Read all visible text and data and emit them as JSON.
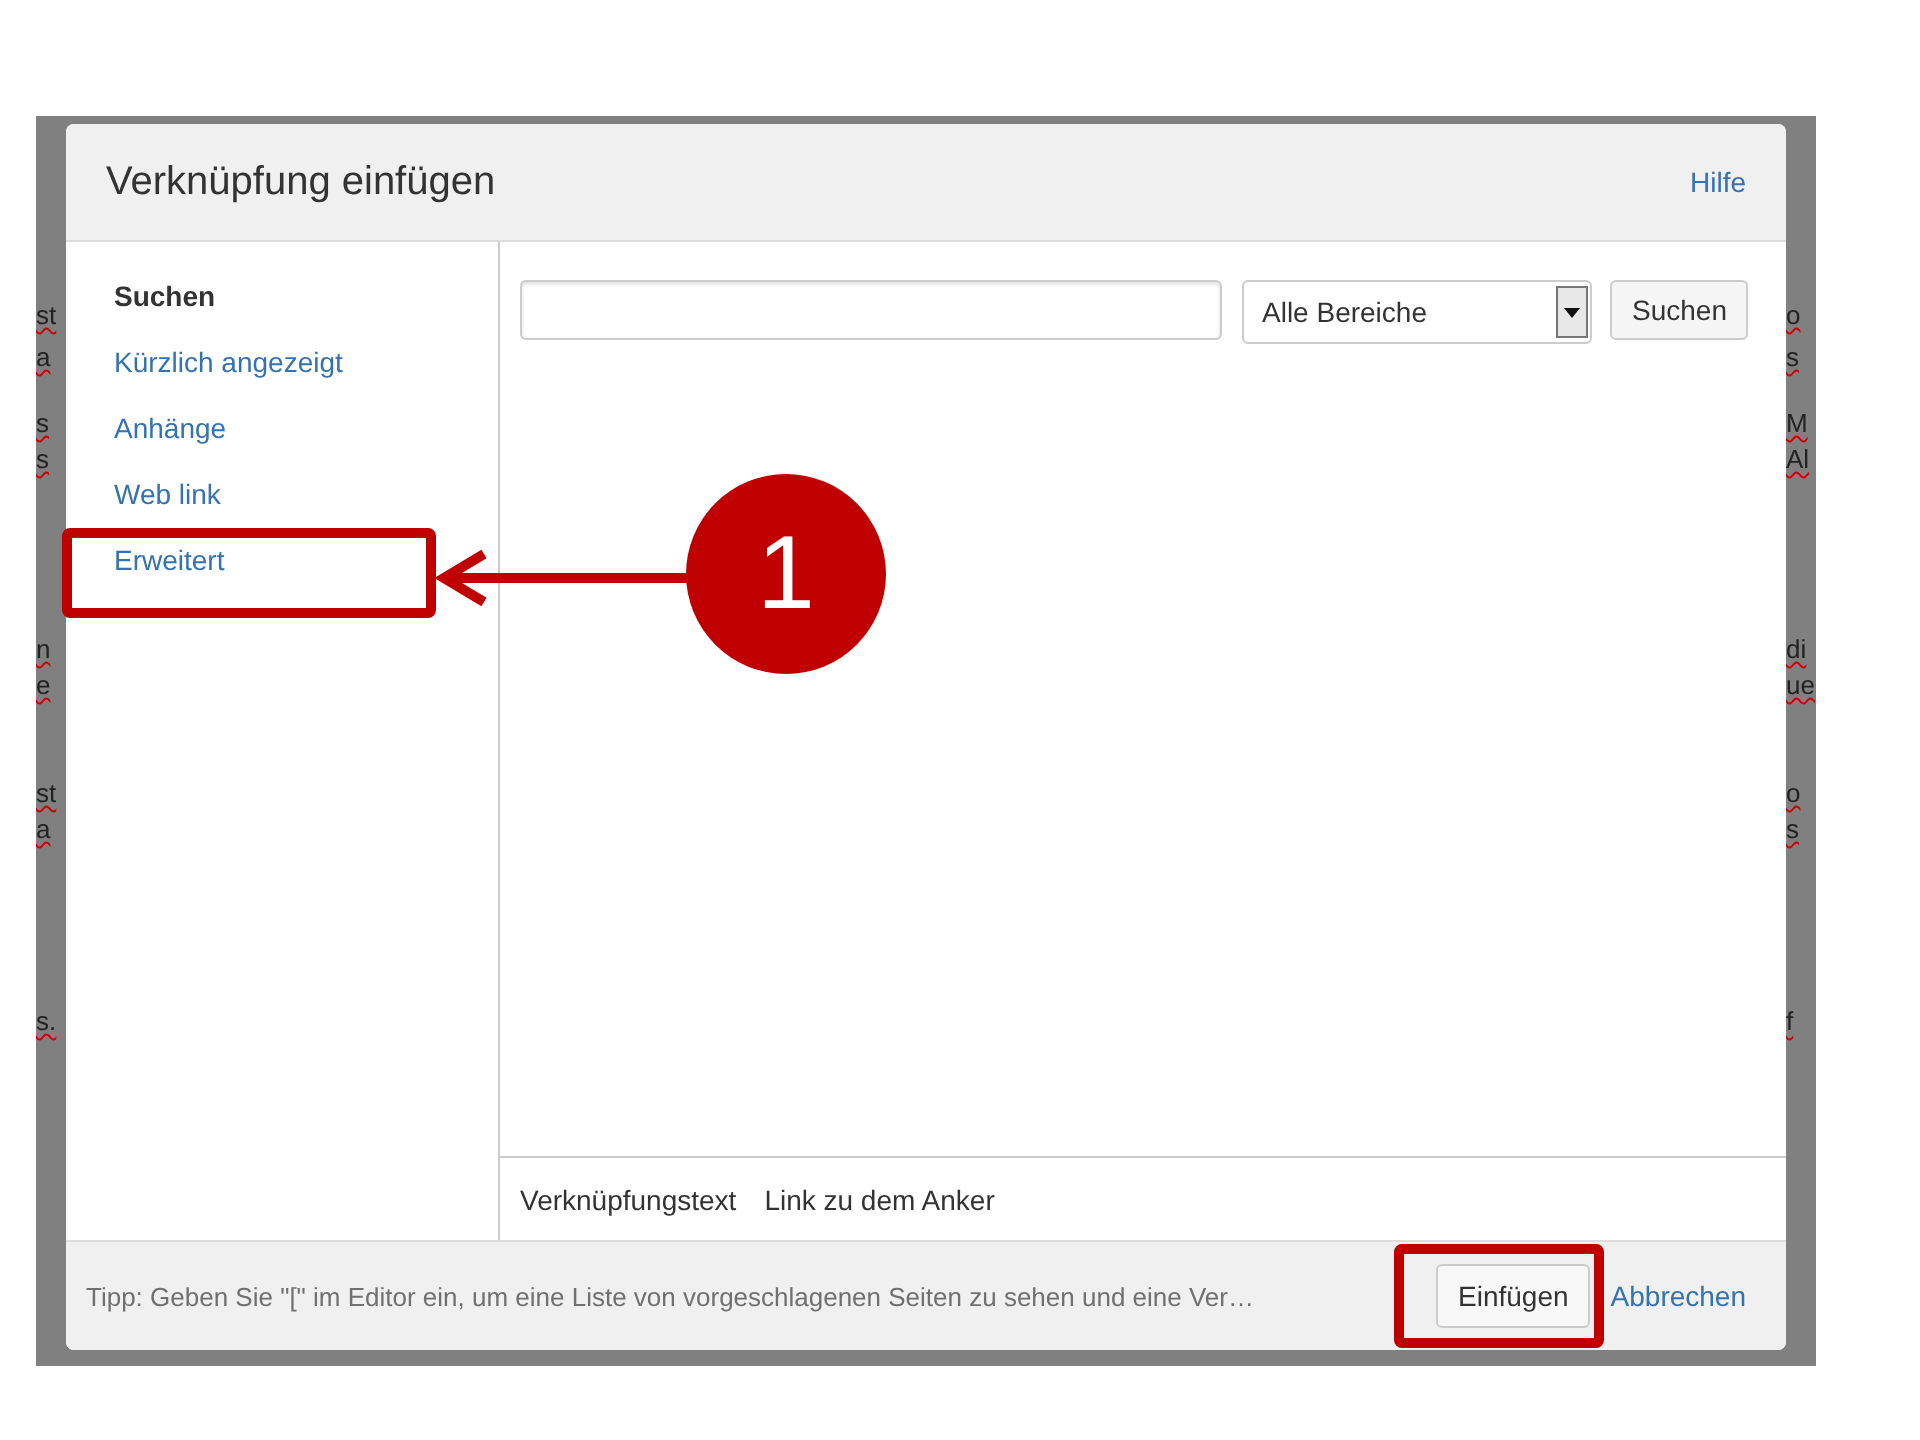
{
  "background_fragments": [
    {
      "left": "st",
      "right": "o"
    },
    {
      "left": "a",
      "right": "s"
    },
    {
      "left": "s",
      "right": "M"
    },
    {
      "left": "s",
      "right": "Al"
    },
    {
      "left": "n",
      "right": "di"
    },
    {
      "left": "e",
      "right": "ue"
    },
    {
      "left": "st",
      "right": "o"
    },
    {
      "left": "a",
      "right": "s"
    },
    {
      "left": "s.",
      "right": "f"
    }
  ],
  "dialog": {
    "title": "Verknüpfung einfügen",
    "help_link": "Hilfe",
    "nav_items": [
      {
        "label": "Suchen",
        "selected": true
      },
      {
        "label": "Kürzlich angezeigt",
        "selected": false
      },
      {
        "label": "Anhänge",
        "selected": false
      },
      {
        "label": "Web link",
        "selected": false
      },
      {
        "label": "Erweitert",
        "selected": false
      }
    ],
    "search": {
      "scope_dropdown": "Alle Bereiche",
      "button": "Suchen"
    },
    "link_text": {
      "label": "Verknüpfungstext",
      "value": "Link zu dem Anker"
    },
    "footer": {
      "tip": "Tipp: Geben Sie \"[\" im Editor ein, um eine Liste von vorgeschlagenen Seiten zu sehen und eine Ver…",
      "insert_button": "Einfügen",
      "cancel_link": "Abbrechen"
    }
  },
  "annotation": {
    "step_number": "1"
  }
}
